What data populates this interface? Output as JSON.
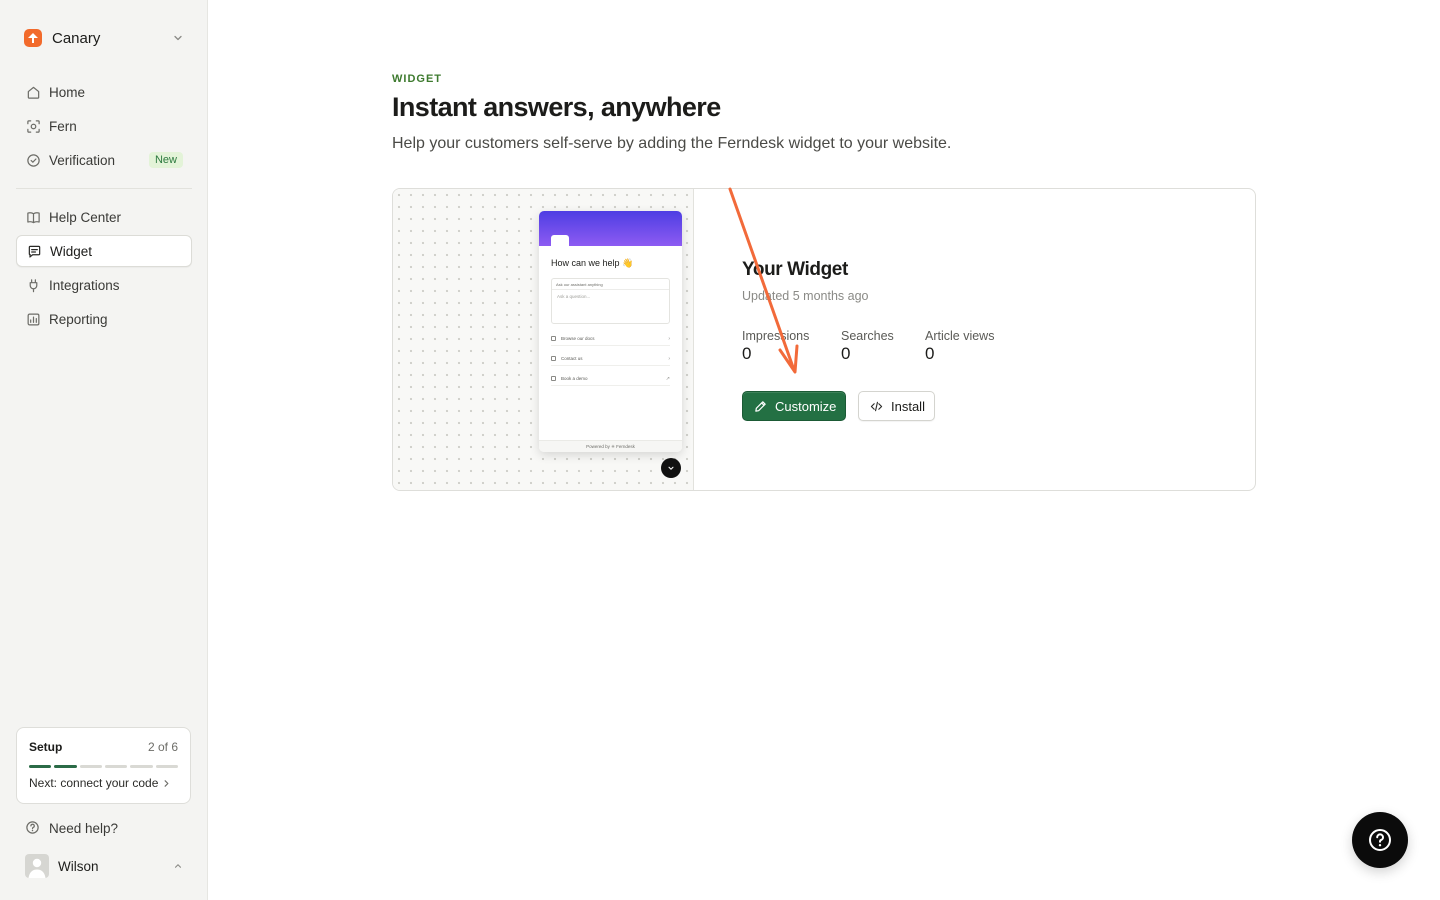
{
  "workspace": {
    "name": "Canary"
  },
  "nav": {
    "primary": [
      {
        "label": "Home",
        "icon": "home-icon"
      },
      {
        "label": "Fern",
        "icon": "fern-scan-icon"
      },
      {
        "label": "Verification",
        "icon": "badge-check-icon",
        "badge": "New"
      }
    ],
    "secondary": [
      {
        "label": "Help Center",
        "icon": "book-icon"
      },
      {
        "label": "Widget",
        "icon": "message-icon",
        "active": true
      },
      {
        "label": "Integrations",
        "icon": "plug-icon"
      },
      {
        "label": "Reporting",
        "icon": "chart-icon"
      }
    ]
  },
  "setup": {
    "title": "Setup",
    "count": "2 of 6",
    "steps_done": 2,
    "steps_total": 6,
    "next": "Next: connect your code"
  },
  "footer": {
    "help": "Need help?",
    "user": "Wilson"
  },
  "page": {
    "eyebrow": "WIDGET",
    "title": "Instant answers, anywhere",
    "subtitle": "Help your customers self-serve by adding the Ferndesk widget to your website."
  },
  "preview": {
    "greeting": "How can we help 👋",
    "ask_ai": "Ask our assistant anything",
    "ask_placeholder": "Ask a question...",
    "options": [
      "Browse our docs",
      "Contact us",
      "Book a demo"
    ],
    "powered_by": "Powered by ✳ Ferndesk"
  },
  "widget": {
    "title": "Your Widget",
    "updated": "Updated 5 months ago",
    "stats": [
      {
        "label": "Impressions",
        "value": "0"
      },
      {
        "label": "Searches",
        "value": "0"
      },
      {
        "label": "Article views",
        "value": "0"
      }
    ],
    "customize_label": "Customize",
    "install_label": "Install"
  },
  "colors": {
    "accent_green": "#237043",
    "eyebrow_green": "#3d7a2e",
    "brand_orange": "#f26a2b",
    "annotation": "#f26a3a"
  }
}
